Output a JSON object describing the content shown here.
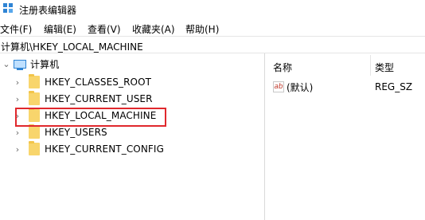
{
  "window": {
    "title": "注册表编辑器"
  },
  "menu": [
    {
      "label": "文件(F)"
    },
    {
      "label": "编辑(E)"
    },
    {
      "label": "查看(V)"
    },
    {
      "label": "收藏夹(A)"
    },
    {
      "label": "帮助(H)"
    }
  ],
  "address": "计算机\\HKEY_LOCAL_MACHINE",
  "tree": {
    "root": {
      "label": "计算机",
      "expanded": true,
      "chevron": "⌄"
    },
    "children": [
      {
        "label": "HKEY_CLASSES_ROOT",
        "chevron": "›"
      },
      {
        "label": "HKEY_CURRENT_USER",
        "chevron": "›"
      },
      {
        "label": "HKEY_LOCAL_MACHINE",
        "chevron": "›",
        "highlighted": true
      },
      {
        "label": "HKEY_USERS",
        "chevron": "›"
      },
      {
        "label": "HKEY_CURRENT_CONFIG",
        "chevron": "›"
      }
    ]
  },
  "list": {
    "columns": {
      "name": "名称",
      "type": "类型"
    },
    "rows": [
      {
        "icon": "ab",
        "name": "(默认)",
        "type": "REG_SZ"
      }
    ]
  },
  "colors": {
    "highlight_border": "#e0282d",
    "folder": "#f8d56c"
  }
}
